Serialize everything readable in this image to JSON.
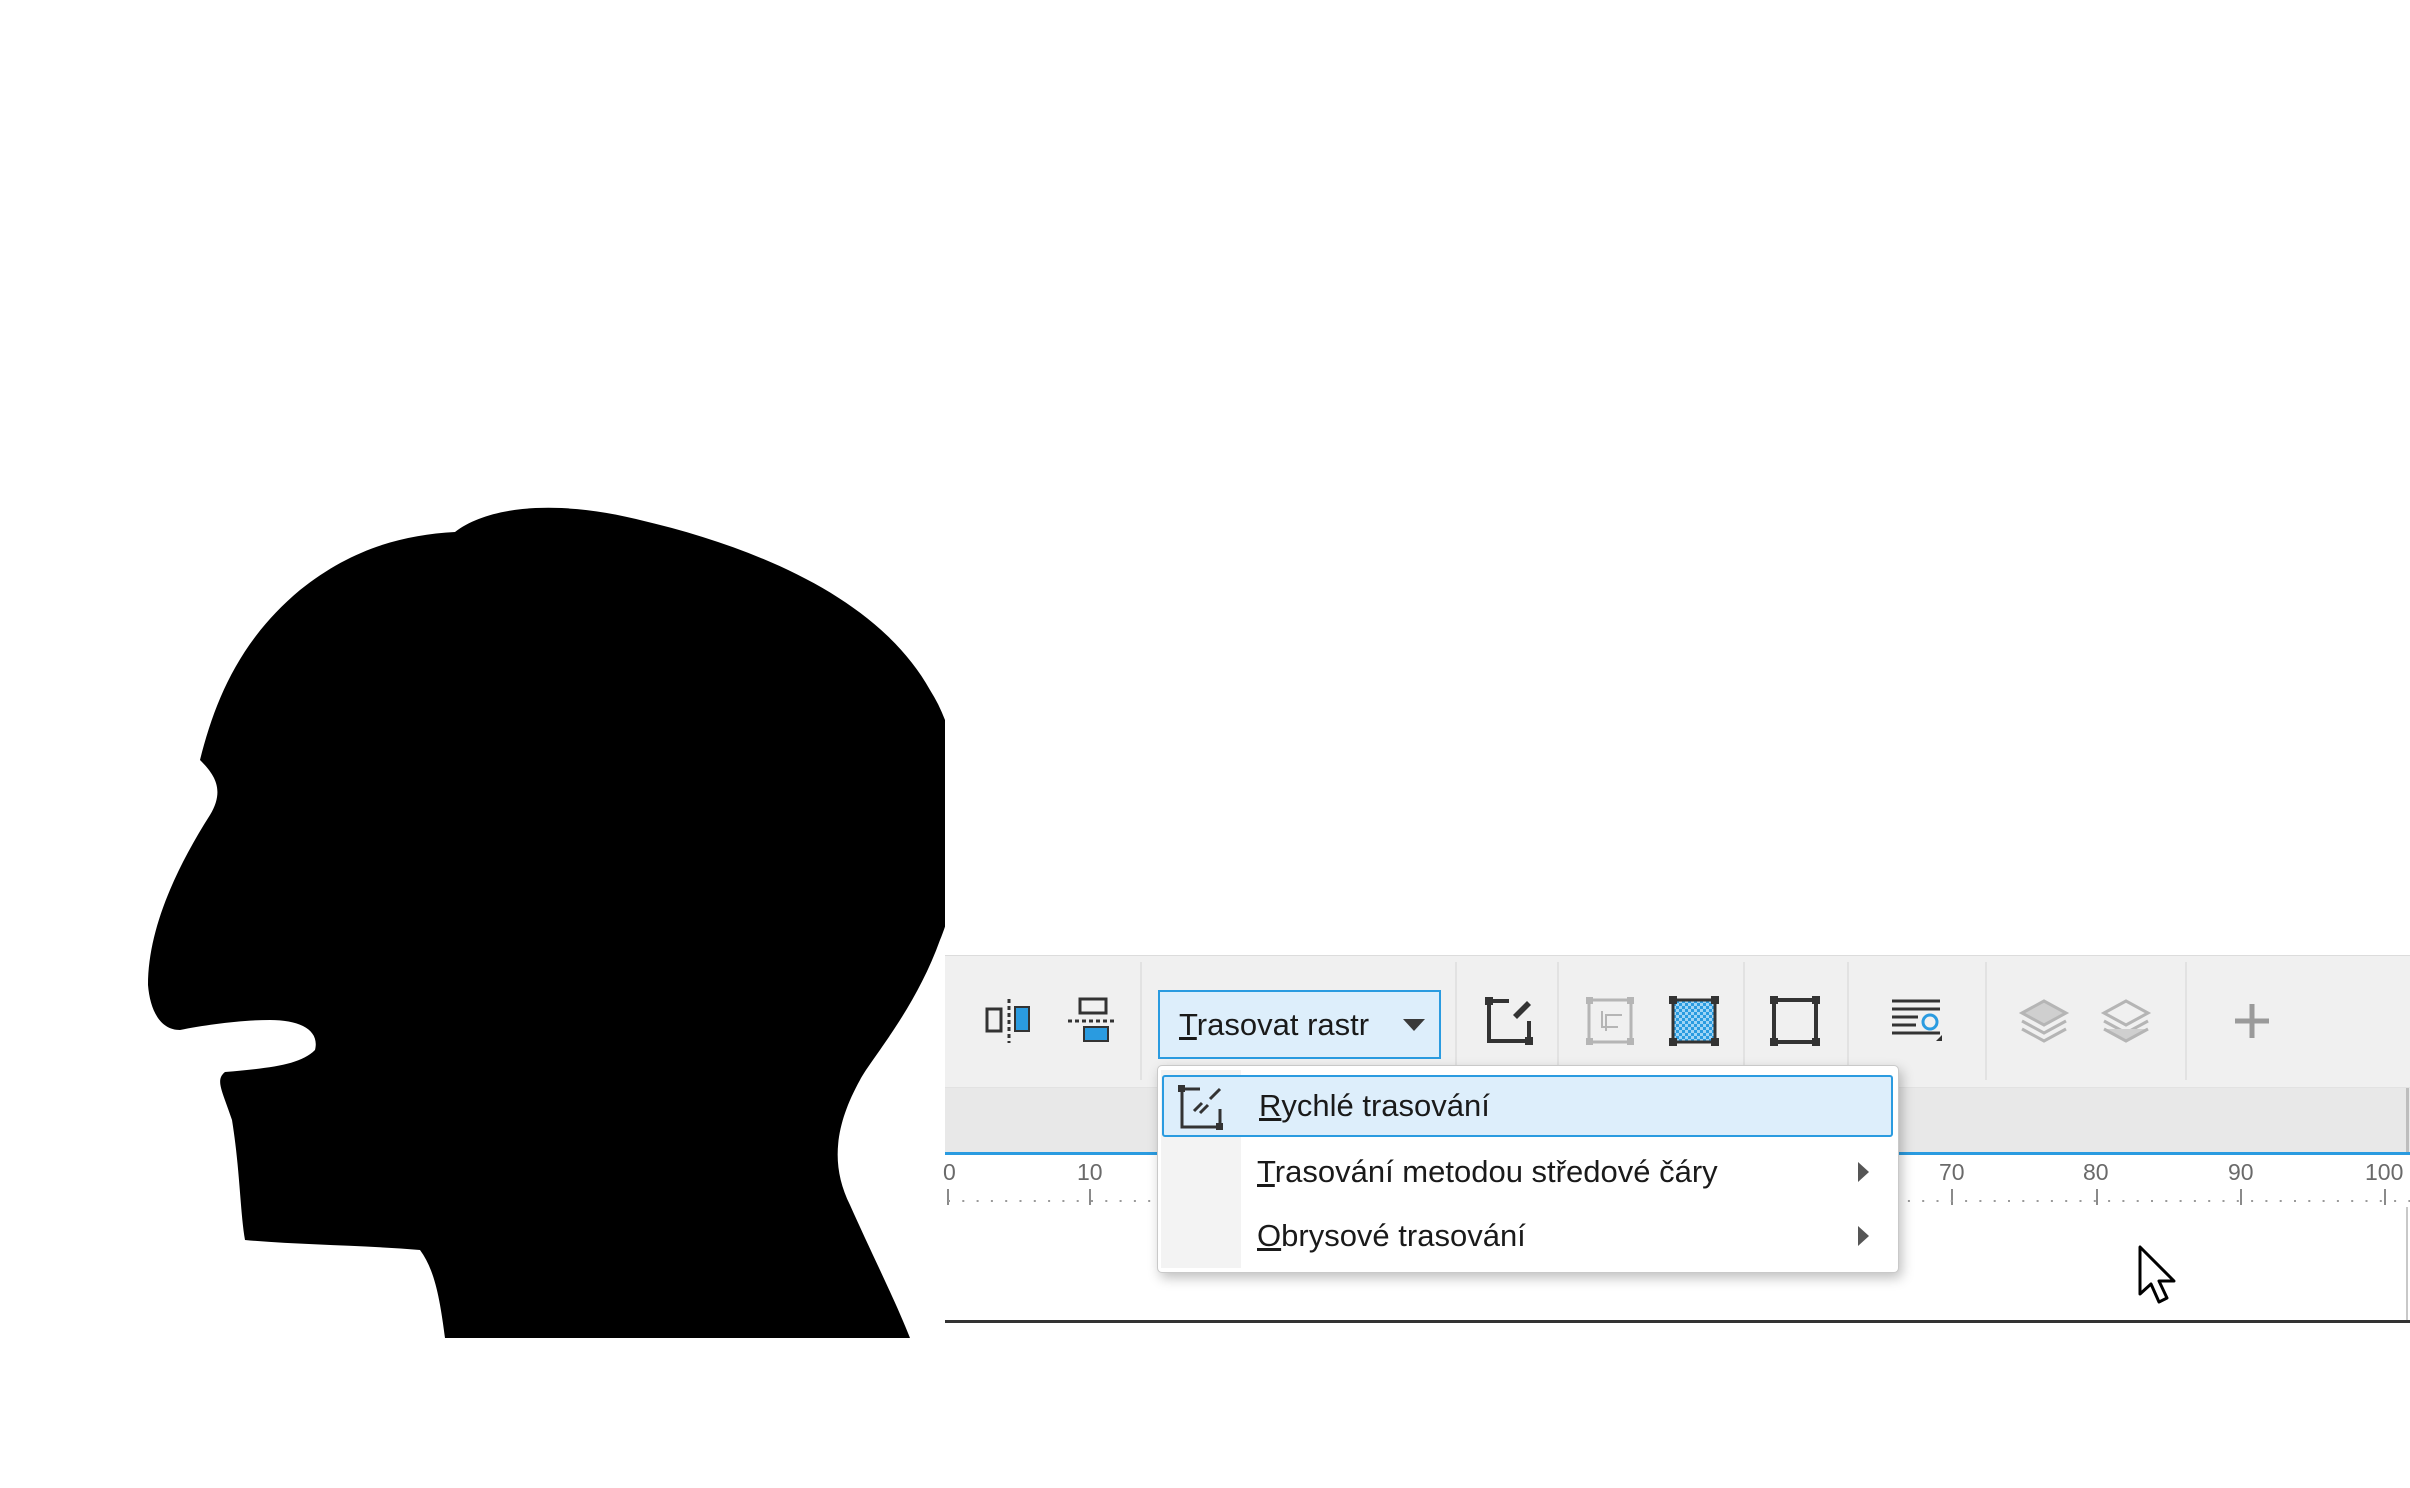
{
  "toolbar": {
    "trace_button": {
      "accel": "T",
      "rest": "rasovat rastr"
    },
    "icons": [
      "align-icon",
      "distribute-icon",
      "edit-bitmap-icon",
      "crop-bitmap-icon",
      "bitmap-color-mask-icon",
      "bounding-box-icon",
      "text-wrap-icon",
      "bring-forward-icon",
      "send-backward-icon",
      "add-icon"
    ]
  },
  "menu": {
    "items": [
      {
        "accel": "R",
        "rest": "ychlé trasování",
        "icon": "quick-trace-icon",
        "submenu": false,
        "highlighted": true
      },
      {
        "accel": "T",
        "rest": "rasování metodou středové čáry",
        "submenu": true,
        "highlighted": false
      },
      {
        "accel": "O",
        "rest": "brysové trasování",
        "submenu": true,
        "highlighted": false
      }
    ]
  },
  "ruler": {
    "labels": [
      "0",
      "10",
      "70",
      "80",
      "90",
      "100"
    ]
  },
  "colors": {
    "accent": "#2a9be0",
    "highlight": "#ddeefb",
    "toolbar_bg": "#f0f0f0",
    "silhouette": "#000000"
  }
}
